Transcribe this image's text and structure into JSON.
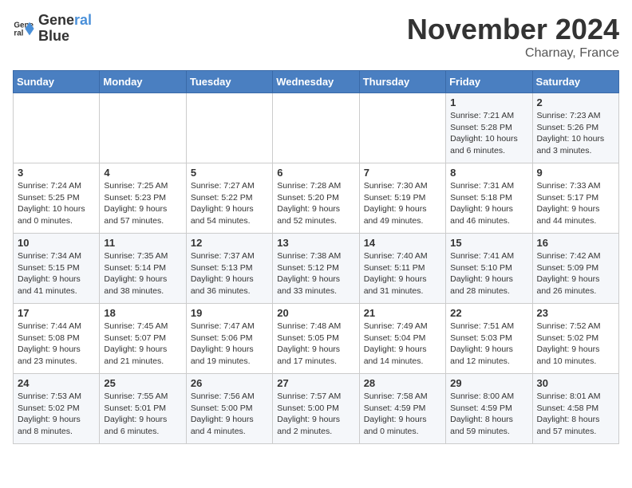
{
  "header": {
    "logo_line1": "General",
    "logo_line2": "Blue",
    "month": "November 2024",
    "location": "Charnay, France"
  },
  "weekdays": [
    "Sunday",
    "Monday",
    "Tuesday",
    "Wednesday",
    "Thursday",
    "Friday",
    "Saturday"
  ],
  "weeks": [
    [
      {
        "day": "",
        "content": ""
      },
      {
        "day": "",
        "content": ""
      },
      {
        "day": "",
        "content": ""
      },
      {
        "day": "",
        "content": ""
      },
      {
        "day": "",
        "content": ""
      },
      {
        "day": "1",
        "content": "Sunrise: 7:21 AM\nSunset: 5:28 PM\nDaylight: 10 hours and 6 minutes."
      },
      {
        "day": "2",
        "content": "Sunrise: 7:23 AM\nSunset: 5:26 PM\nDaylight: 10 hours and 3 minutes."
      }
    ],
    [
      {
        "day": "3",
        "content": "Sunrise: 7:24 AM\nSunset: 5:25 PM\nDaylight: 10 hours and 0 minutes."
      },
      {
        "day": "4",
        "content": "Sunrise: 7:25 AM\nSunset: 5:23 PM\nDaylight: 9 hours and 57 minutes."
      },
      {
        "day": "5",
        "content": "Sunrise: 7:27 AM\nSunset: 5:22 PM\nDaylight: 9 hours and 54 minutes."
      },
      {
        "day": "6",
        "content": "Sunrise: 7:28 AM\nSunset: 5:20 PM\nDaylight: 9 hours and 52 minutes."
      },
      {
        "day": "7",
        "content": "Sunrise: 7:30 AM\nSunset: 5:19 PM\nDaylight: 9 hours and 49 minutes."
      },
      {
        "day": "8",
        "content": "Sunrise: 7:31 AM\nSunset: 5:18 PM\nDaylight: 9 hours and 46 minutes."
      },
      {
        "day": "9",
        "content": "Sunrise: 7:33 AM\nSunset: 5:17 PM\nDaylight: 9 hours and 44 minutes."
      }
    ],
    [
      {
        "day": "10",
        "content": "Sunrise: 7:34 AM\nSunset: 5:15 PM\nDaylight: 9 hours and 41 minutes."
      },
      {
        "day": "11",
        "content": "Sunrise: 7:35 AM\nSunset: 5:14 PM\nDaylight: 9 hours and 38 minutes."
      },
      {
        "day": "12",
        "content": "Sunrise: 7:37 AM\nSunset: 5:13 PM\nDaylight: 9 hours and 36 minutes."
      },
      {
        "day": "13",
        "content": "Sunrise: 7:38 AM\nSunset: 5:12 PM\nDaylight: 9 hours and 33 minutes."
      },
      {
        "day": "14",
        "content": "Sunrise: 7:40 AM\nSunset: 5:11 PM\nDaylight: 9 hours and 31 minutes."
      },
      {
        "day": "15",
        "content": "Sunrise: 7:41 AM\nSunset: 5:10 PM\nDaylight: 9 hours and 28 minutes."
      },
      {
        "day": "16",
        "content": "Sunrise: 7:42 AM\nSunset: 5:09 PM\nDaylight: 9 hours and 26 minutes."
      }
    ],
    [
      {
        "day": "17",
        "content": "Sunrise: 7:44 AM\nSunset: 5:08 PM\nDaylight: 9 hours and 23 minutes."
      },
      {
        "day": "18",
        "content": "Sunrise: 7:45 AM\nSunset: 5:07 PM\nDaylight: 9 hours and 21 minutes."
      },
      {
        "day": "19",
        "content": "Sunrise: 7:47 AM\nSunset: 5:06 PM\nDaylight: 9 hours and 19 minutes."
      },
      {
        "day": "20",
        "content": "Sunrise: 7:48 AM\nSunset: 5:05 PM\nDaylight: 9 hours and 17 minutes."
      },
      {
        "day": "21",
        "content": "Sunrise: 7:49 AM\nSunset: 5:04 PM\nDaylight: 9 hours and 14 minutes."
      },
      {
        "day": "22",
        "content": "Sunrise: 7:51 AM\nSunset: 5:03 PM\nDaylight: 9 hours and 12 minutes."
      },
      {
        "day": "23",
        "content": "Sunrise: 7:52 AM\nSunset: 5:02 PM\nDaylight: 9 hours and 10 minutes."
      }
    ],
    [
      {
        "day": "24",
        "content": "Sunrise: 7:53 AM\nSunset: 5:02 PM\nDaylight: 9 hours and 8 minutes."
      },
      {
        "day": "25",
        "content": "Sunrise: 7:55 AM\nSunset: 5:01 PM\nDaylight: 9 hours and 6 minutes."
      },
      {
        "day": "26",
        "content": "Sunrise: 7:56 AM\nSunset: 5:00 PM\nDaylight: 9 hours and 4 minutes."
      },
      {
        "day": "27",
        "content": "Sunrise: 7:57 AM\nSunset: 5:00 PM\nDaylight: 9 hours and 2 minutes."
      },
      {
        "day": "28",
        "content": "Sunrise: 7:58 AM\nSunset: 4:59 PM\nDaylight: 9 hours and 0 minutes."
      },
      {
        "day": "29",
        "content": "Sunrise: 8:00 AM\nSunset: 4:59 PM\nDaylight: 8 hours and 59 minutes."
      },
      {
        "day": "30",
        "content": "Sunrise: 8:01 AM\nSunset: 4:58 PM\nDaylight: 8 hours and 57 minutes."
      }
    ]
  ]
}
